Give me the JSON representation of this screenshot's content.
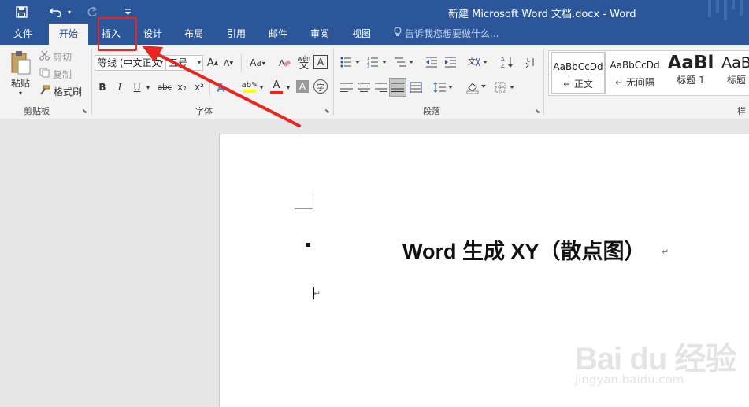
{
  "window": {
    "title": "新建 Microsoft Word 文档.docx - Word",
    "title_bar_color": "#2b579a"
  },
  "quick_access": {
    "save_icon": "save-icon",
    "undo_icon": "undo-icon",
    "redo_icon": "redo-icon",
    "customize_icon": "customize-qat-icon"
  },
  "tabs": [
    {
      "label": "文件"
    },
    {
      "label": "开始"
    },
    {
      "label": "插入"
    },
    {
      "label": "设计"
    },
    {
      "label": "布局"
    },
    {
      "label": "引用"
    },
    {
      "label": "邮件"
    },
    {
      "label": "审阅"
    },
    {
      "label": "视图"
    }
  ],
  "tell_me": {
    "placeholder": "告诉我您想要做什么...",
    "icon": "lightbulb-icon"
  },
  "annotation": {
    "highlight_color": "#e8251f"
  },
  "clipboard": {
    "paste_label": "粘贴",
    "cut_label": "剪切",
    "copy_label": "复制",
    "format_painter_label": "格式刷",
    "group_label": "剪贴板"
  },
  "font": {
    "font_name": "等线 (中文正文",
    "font_size": "五号",
    "group_label": "字体",
    "bold": "B",
    "italic": "I",
    "underline": "U",
    "strikethrough": "abc",
    "subscript": "x₂",
    "superscript": "x²",
    "change_case": "Aa",
    "phonetic": "wén",
    "phonetic_char": "文",
    "font_color": "A",
    "char_shading": "A",
    "enclose": "字",
    "grow_font": "A",
    "shrink_font": "A",
    "font_color_swatch": "#e8251f",
    "highlight_swatch": "#ffff00"
  },
  "paragraph": {
    "group_label": "段落"
  },
  "styles": {
    "items": [
      {
        "sample": "AaBbCcDd",
        "name": "↵ 正文"
      },
      {
        "sample": "AaBbCcDd",
        "name": "↵ 无间隔"
      },
      {
        "sample": "AaBl",
        "name": "标题 1"
      },
      {
        "sample": "AaB",
        "name": "标题"
      }
    ],
    "group_label_partial": "样"
  },
  "document": {
    "title": "Word 生成 XY（散点图）",
    "paragraph_mark": "↵"
  },
  "watermark": {
    "brand": "Bai du 经验",
    "url": "jingyan.baidu.com"
  }
}
